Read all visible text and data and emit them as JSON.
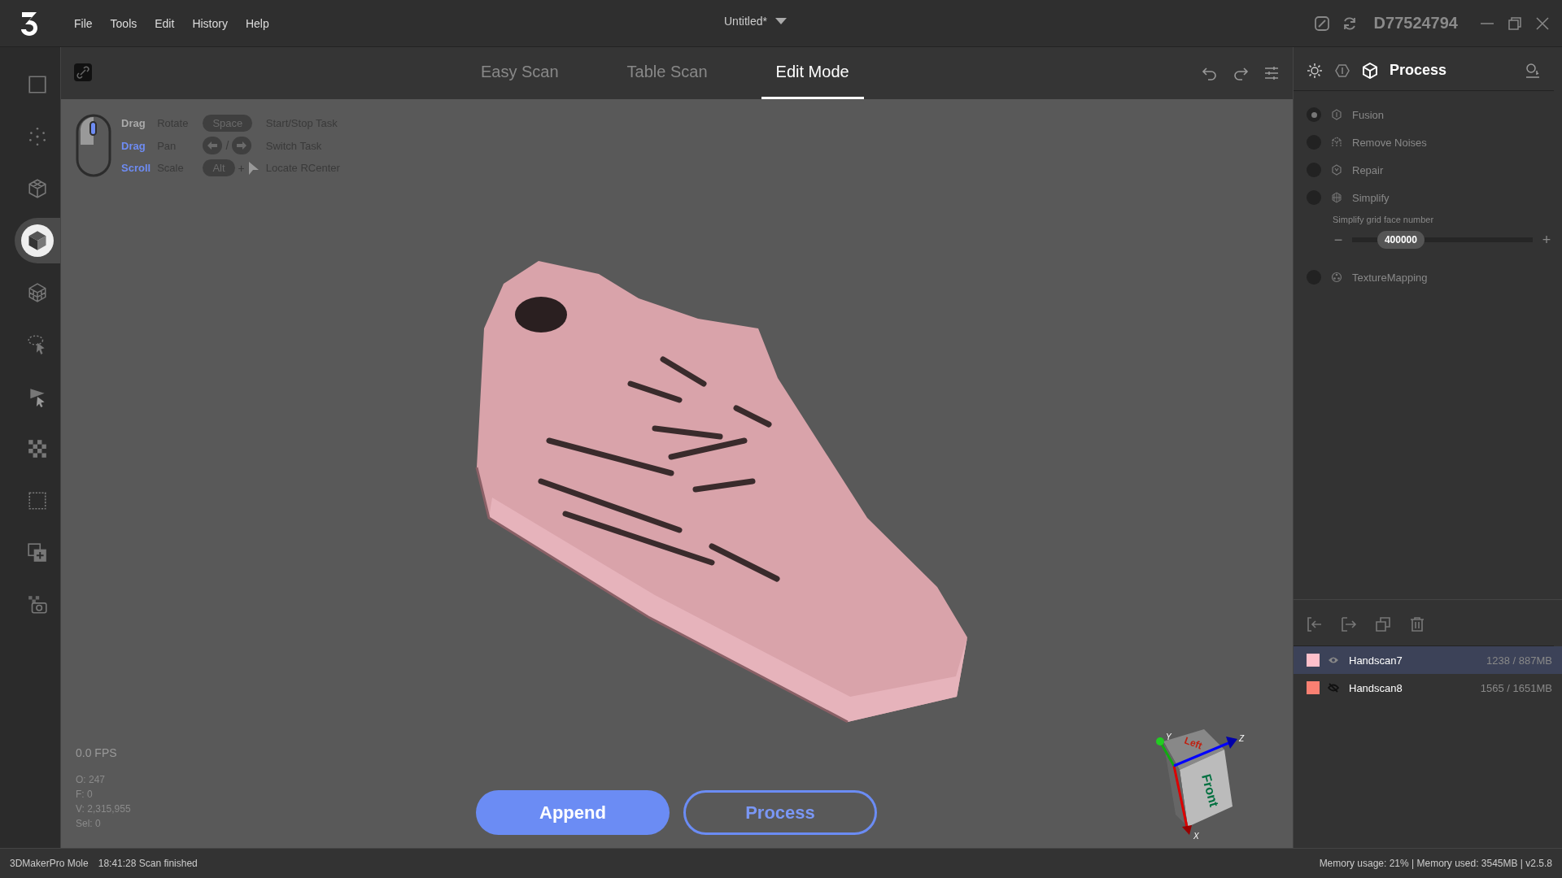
{
  "title_bar": {
    "menus": [
      "File",
      "Tools",
      "Edit",
      "History",
      "Help"
    ],
    "document": "Untitled*",
    "device_id": "D77524794"
  },
  "tools": [
    {
      "kind": "frame",
      "selected": false
    },
    {
      "kind": "points",
      "selected": false
    },
    {
      "kind": "wire-cube",
      "selected": false
    },
    {
      "kind": "solid-cube",
      "selected": true
    },
    {
      "kind": "mesh-cube",
      "selected": false
    },
    {
      "kind": "lasso",
      "selected": false
    },
    {
      "kind": "flag-pointer",
      "selected": false
    },
    {
      "kind": "checker",
      "selected": false
    },
    {
      "kind": "dashed-frame",
      "selected": false
    },
    {
      "kind": "layer-add",
      "selected": false
    },
    {
      "kind": "camera",
      "selected": false
    }
  ],
  "viewport": {
    "tabs": [
      {
        "label": "Easy Scan",
        "selected": false
      },
      {
        "label": "Table Scan",
        "selected": false
      },
      {
        "label": "Edit Mode",
        "selected": true
      }
    ],
    "hints": [
      {
        "key": "Drag",
        "highlight": false,
        "action": "Rotate",
        "shortcut": {
          "kind": "key",
          "label": "Space"
        },
        "description": "Start/Stop Task"
      },
      {
        "key": "Drag",
        "highlight": true,
        "action": "Pan",
        "shortcut": {
          "kind": "arrows",
          "separator": "/"
        },
        "description": "Switch Task"
      },
      {
        "key": "Scroll",
        "highlight": true,
        "action": "Scale",
        "shortcut": {
          "kind": "key-click",
          "label": "Alt",
          "joiner": "+"
        },
        "description": "Locate RCenter"
      }
    ],
    "fps": "0.0 FPS",
    "stats": [
      "O: 247",
      "F: 0",
      "V: 2,315,955",
      "Sel: 0"
    ],
    "buttons": [
      {
        "label": "Append",
        "kind": "primary"
      },
      {
        "label": "Process",
        "kind": "outline"
      }
    ],
    "view_cube": {
      "top_face": "Left",
      "front_face": "Front",
      "axis_x": "X",
      "axis_y": "Y",
      "axis_z": "Z"
    }
  },
  "process_panel": {
    "title": "Process",
    "steps": [
      {
        "label": "Fusion",
        "kind": "fusion",
        "selected": true
      },
      {
        "label": "Remove Noises",
        "kind": "noise",
        "selected": false
      },
      {
        "label": "Repair",
        "kind": "repair",
        "selected": false
      },
      {
        "label": "Simplify",
        "kind": "simplify",
        "selected": false,
        "slider": {
          "label": "Simplify grid face number",
          "value": "400000",
          "level": 0.27,
          "decrease": "−",
          "increase": "+"
        }
      },
      {
        "label": "TextureMapping",
        "kind": "texture",
        "selected": false
      }
    ],
    "layers": [
      {
        "name": "Handscan7",
        "color": "#ffc0cb",
        "visible": true,
        "selected": true,
        "size": "1238 / 887MB"
      },
      {
        "name": "Handscan8",
        "color": "#fa8072",
        "visible": false,
        "selected": false,
        "size": "1565 / 1651MB"
      }
    ]
  },
  "status_bar": {
    "device": "3DMakerPro Mole",
    "message": "18:41:28 Scan finished",
    "memory": "Memory usage: 21% | Memory used: 3545MB | v2.5.8"
  }
}
